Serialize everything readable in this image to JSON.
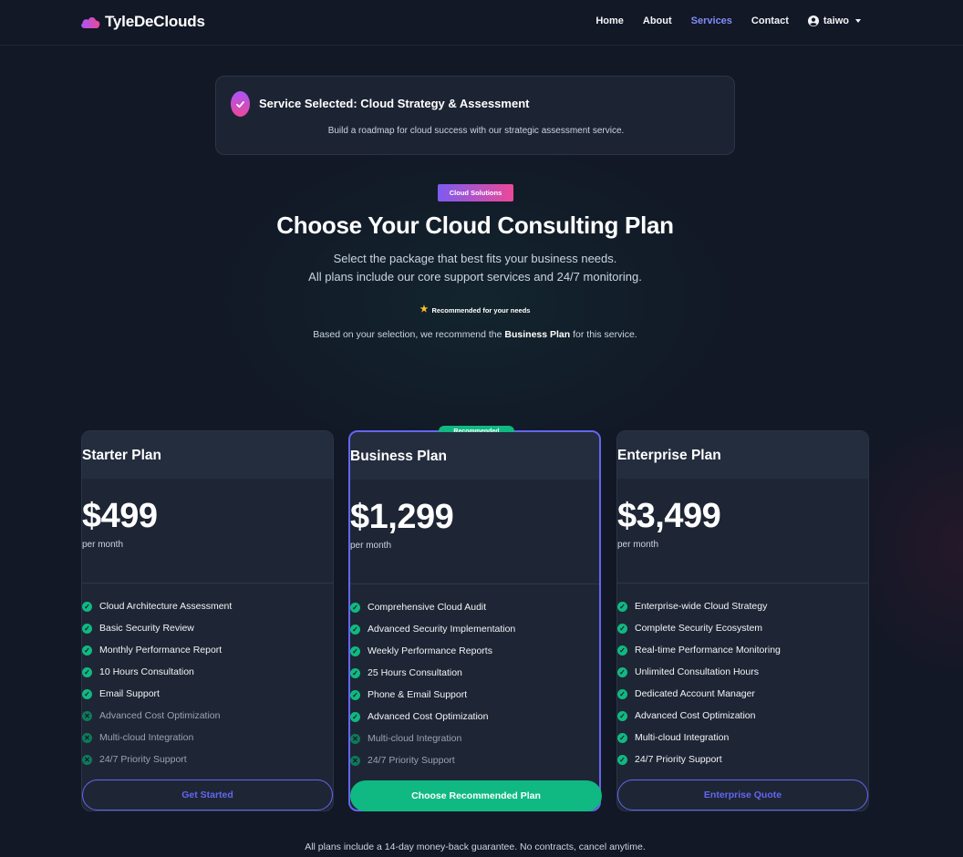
{
  "nav": {
    "brand": "TyleDeClouds",
    "links": [
      "Home",
      "About",
      "Services",
      "Contact"
    ],
    "active": "Services",
    "user": "taiwo"
  },
  "service": {
    "title": "Service Selected: Cloud Strategy & Assessment",
    "description": "Build a roadmap for cloud success with our strategic assessment service."
  },
  "hero": {
    "badge": "Cloud Solutions",
    "title": "Choose Your Cloud Consulting Plan",
    "subtitle_line1": "Select the package that best fits your business needs.",
    "subtitle_line2": "All plans include our core support services and 24/7 monitoring.",
    "recommended_label": "Recommended for your needs",
    "rec_prefix": "Based on your selection, we recommend the ",
    "rec_plan": "Business Plan",
    "rec_suffix": " for this service."
  },
  "plans": [
    {
      "name": "Starter Plan",
      "price": "$499",
      "period": "per month",
      "button": "Get Started",
      "features": [
        {
          "text": "Cloud Architecture Assessment",
          "included": true
        },
        {
          "text": "Basic Security Review",
          "included": true
        },
        {
          "text": "Monthly Performance Report",
          "included": true
        },
        {
          "text": "10 Hours Consultation",
          "included": true
        },
        {
          "text": "Email Support",
          "included": true
        },
        {
          "text": "Advanced Cost Optimization",
          "included": false
        },
        {
          "text": "Multi-cloud Integration",
          "included": false
        },
        {
          "text": "24/7 Priority Support",
          "included": false
        }
      ]
    },
    {
      "name": "Business Plan",
      "price": "$1,299",
      "period": "per month",
      "button": "Choose Recommended Plan",
      "badge": "Recommended",
      "features": [
        {
          "text": "Comprehensive Cloud Audit",
          "included": true
        },
        {
          "text": "Advanced Security Implementation",
          "included": true
        },
        {
          "text": "Weekly Performance Reports",
          "included": true
        },
        {
          "text": "25 Hours Consultation",
          "included": true
        },
        {
          "text": "Phone & Email Support",
          "included": true
        },
        {
          "text": "Advanced Cost Optimization",
          "included": true
        },
        {
          "text": "Multi-cloud Integration",
          "included": false
        },
        {
          "text": "24/7 Priority Support",
          "included": false
        }
      ]
    },
    {
      "name": "Enterprise Plan",
      "price": "$3,499",
      "period": "per month",
      "button": "Enterprise Quote",
      "features": [
        {
          "text": "Enterprise-wide Cloud Strategy",
          "included": true
        },
        {
          "text": "Complete Security Ecosystem",
          "included": true
        },
        {
          "text": "Real-time Performance Monitoring",
          "included": true
        },
        {
          "text": "Unlimited Consultation Hours",
          "included": true
        },
        {
          "text": "Dedicated Account Manager",
          "included": true
        },
        {
          "text": "Advanced Cost Optimization",
          "included": true
        },
        {
          "text": "Multi-cloud Integration",
          "included": true
        },
        {
          "text": "24/7 Priority Support",
          "included": true
        }
      ]
    }
  ],
  "footer": {
    "note": "All plans include a 14-day money-back guarantee. No contracts, cancel anytime."
  },
  "colors": {
    "background": "#121826",
    "accent": "#6366f1",
    "success": "#10b981",
    "badge_gradient_start": "#7c5cf0",
    "badge_gradient_end": "#ec4899"
  }
}
